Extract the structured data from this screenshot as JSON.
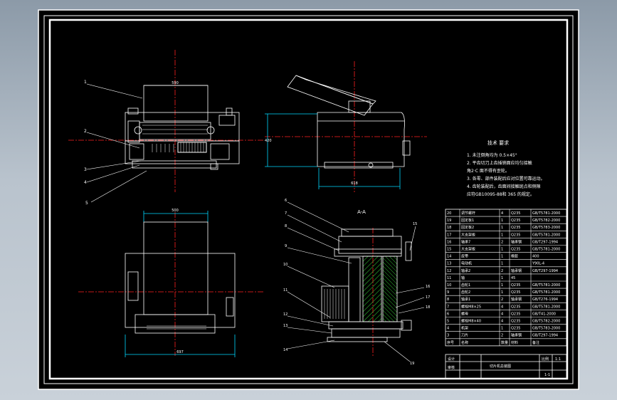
{
  "drawing": {
    "colors": {
      "background": "#000000",
      "line": "#ffffff",
      "center_line": "#ff2020",
      "dimension": "#00d8ff",
      "hatch": "#2fb82f",
      "frame": "#ffffff"
    },
    "dimensions": {
      "front_width": "590",
      "side_width": "618",
      "side_height": "420",
      "top_width": "500",
      "bottom_width": "697"
    },
    "front_view_labels": [
      "1",
      "2",
      "3",
      "4",
      "5"
    ],
    "section_title": "A-A",
    "section_labels_left": [
      "6",
      "7",
      "8",
      "9",
      "10",
      "11",
      "12",
      "13",
      "14"
    ],
    "section_labels_right": [
      "15",
      "16",
      "17",
      "18",
      "19"
    ]
  },
  "notes": {
    "title": "技术 要求",
    "lines": [
      "1. 未注倒角均为 0.5×45°",
      "2. 平齿切刀上齿插销面应均匀接触",
      "角2·C 面不得有歪轮。",
      "3. 各零、部件装配后应对位置可靠运动。",
      "4. 齿轮装配后，齿面间接触斑点和侧隙",
      "应符GB10095-88和 365 的规定。"
    ]
  },
  "title_block": {
    "rows": [
      [
        "20",
        "调节螺杆",
        "4",
        "Q235",
        "GB/T5781-2000"
      ],
      [
        "19",
        "固定板1",
        "1",
        "Q235",
        "GB/T5782-2000"
      ],
      [
        "18",
        "固定板2",
        "1",
        "Q235",
        "GB/T5783-2000"
      ],
      [
        "17",
        "大支架板",
        "1",
        "Q235",
        "GB/T5781-2000"
      ],
      [
        "16",
        "轴承7",
        "2",
        "轴承钢",
        "GB/T297-1994"
      ],
      [
        "15",
        "大支架板",
        "1",
        "Q235",
        "GB/T5781-2000"
      ],
      [
        "14",
        "皮带",
        "1",
        "橡胶",
        "400"
      ],
      [
        "13",
        "电动机",
        "1",
        "",
        "Y90L-4"
      ],
      [
        "12",
        "轴承2",
        "2",
        "轴承钢",
        "GB/T297-1994"
      ],
      [
        "11",
        "轴",
        "1",
        "45",
        ""
      ],
      [
        "10",
        "齿轮1",
        "1",
        "Q235",
        "GB/T5781-2000"
      ],
      [
        "9",
        "齿轮2",
        "1",
        "Q235",
        "GB/T5781-2000"
      ],
      [
        "8",
        "轴承1",
        "2",
        "轴承钢",
        "GB/T276-1994"
      ],
      [
        "7",
        "螺栓M8×25",
        "4",
        "Q235",
        "GB/T5781-2000"
      ],
      [
        "6",
        "螺母",
        "4",
        "Q235",
        "GB/T41-2000"
      ],
      [
        "5",
        "螺栓M8×40",
        "4",
        "Q235",
        "GB/T5782-2000"
      ],
      [
        "4",
        "机架",
        "1",
        "Q235",
        "GB/T5783-2000"
      ],
      [
        "3",
        "刀片",
        "2",
        "轴承钢",
        "GB/T297-1994"
      ]
    ],
    "header": [
      "序号",
      "名称",
      "数量",
      "材料",
      "备注"
    ],
    "drawing_name": "切片机总装图",
    "scale_label": "比例",
    "scale": "1:1",
    "sheet": "1-1",
    "design_label": "设计",
    "check_label": "审核"
  }
}
